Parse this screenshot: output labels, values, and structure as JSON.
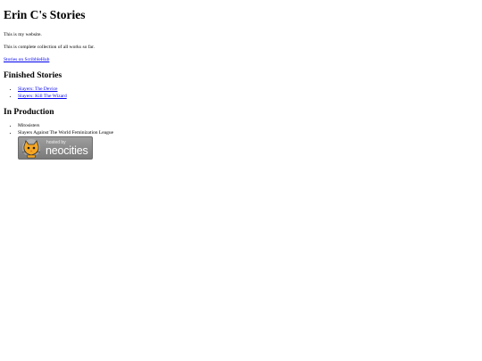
{
  "page": {
    "title": "Erin C's Stories",
    "intro_1": "This is my website.",
    "intro_2": "This is complete collection of all works so far.",
    "scribblehub_link": "Stories on ScribbleHub"
  },
  "finished": {
    "heading": "Finished Stories",
    "items": [
      {
        "label": "Slayers: The Device"
      },
      {
        "label": "Slayers: Kill The Wizard"
      }
    ]
  },
  "in_production": {
    "heading": "In Production",
    "items": [
      {
        "label": "Mitosisters"
      },
      {
        "label": "Slayers Against The World Feminization League"
      }
    ]
  },
  "badge": {
    "small_text": "hosted by",
    "big_text": "neocities",
    "icon": "neocities-cat-icon"
  },
  "colors": {
    "link": "#0000ee",
    "badge_bg": "#8c8c8c",
    "cat_orange": "#f5a623"
  }
}
